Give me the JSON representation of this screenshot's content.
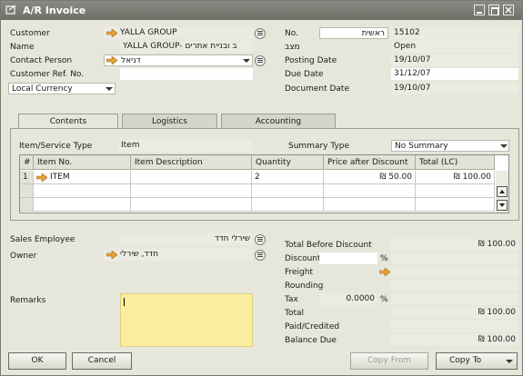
{
  "window": {
    "title": "A/R Invoice"
  },
  "header_left": {
    "customer_label": "Customer",
    "customer_value": "YALLA GROUP",
    "name_label": "Name",
    "name_value": "YALLA GROUP- ב ובניית אתרים",
    "contact_label": "Contact Person",
    "contact_value": "דניאל",
    "ref_label": "Customer Ref. No.",
    "ref_value": "",
    "currency_value": "Local Currency"
  },
  "header_right": {
    "no_label": "No.",
    "series_value": "ראשית",
    "no_value": "15102",
    "status_label": "מצב",
    "status_value": "Open",
    "posting_label": "Posting Date",
    "posting_value": "19/10/07",
    "due_label": "Due Date",
    "due_value": "31/12/07",
    "document_label": "Document Date",
    "document_value": "19/10/07"
  },
  "tabs": [
    {
      "label": "Contents"
    },
    {
      "label": "Logistics"
    },
    {
      "label": "Accounting"
    }
  ],
  "contents": {
    "item_type_label": "Item/Service Type",
    "item_type_value": "Item",
    "summary_label": "Summary Type",
    "summary_value": "No Summary",
    "columns": [
      "#",
      "Item No.",
      "Item Description",
      "Quantity",
      "Price after Discount",
      "Total (LC)"
    ],
    "rows": [
      {
        "num": "1",
        "item_no": "ITEM",
        "description": "",
        "quantity": "2",
        "price": "₪ 50.00",
        "total": "₪ 100.00"
      }
    ]
  },
  "footer_left": {
    "sales_label": "Sales Employee",
    "sales_value": "שירלי חדד",
    "owner_label": "Owner",
    "owner_value": "חדד, שירלי",
    "remarks_label": "Remarks",
    "remarks_value": ""
  },
  "totals": {
    "before_discount_label": "Total Before Discount",
    "before_discount_value": "₪ 100.00",
    "discount_label": "Discount",
    "discount_pct": "%",
    "discount_value": "",
    "freight_label": "Freight",
    "freight_value": "",
    "rounding_label": "Rounding",
    "rounding_value": "",
    "tax_label": "Tax",
    "tax_rate": "0.0000",
    "tax_pct": "%",
    "tax_value": "",
    "total_label": "Total",
    "total_value": "₪ 100.00",
    "paid_label": "Paid/Credited",
    "paid_value": "",
    "balance_label": "Balance Due",
    "balance_value": "₪ 100.00"
  },
  "buttons": {
    "ok": "OK",
    "cancel": "Cancel",
    "copy_from": "Copy From",
    "copy_to": "Copy To"
  },
  "colors": {
    "titlebar": "#7d7d76",
    "arrow": "#e8a23a",
    "remarks_bg": "#fbed9e"
  }
}
